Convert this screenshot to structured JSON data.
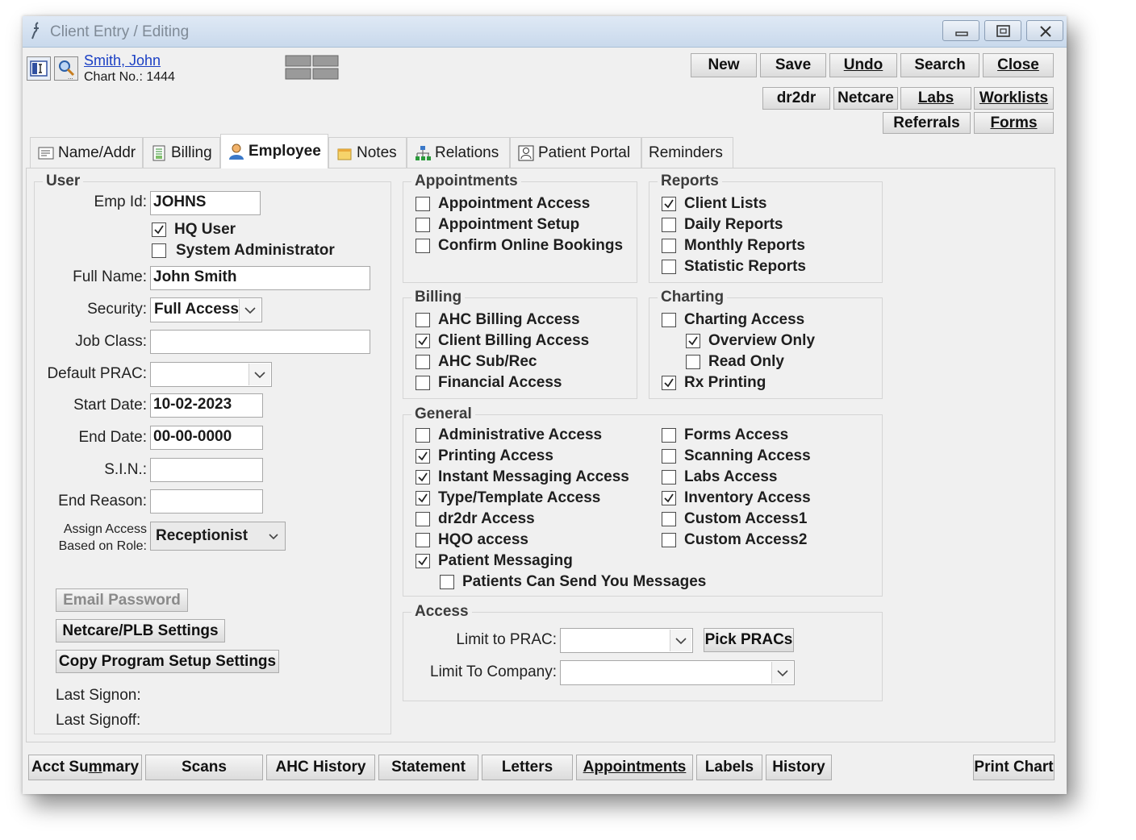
{
  "window": {
    "title": "Client Entry / Editing"
  },
  "patient": {
    "name": "Smith, John",
    "chart": "Chart No.: 1444"
  },
  "toolbar": {
    "new": "New",
    "save": "Save",
    "undo": "Undo",
    "search": "Search",
    "close": "Close",
    "dr2dr": "dr2dr",
    "netcare": "Netcare",
    "labs": "Labs",
    "worklists": "Worklists",
    "referrals": "Referrals",
    "forms": "Forms"
  },
  "tabs": [
    "Name/Addr",
    "Billing",
    "Employee",
    "Notes",
    "Relations",
    "Patient Portal",
    "Reminders"
  ],
  "user": {
    "legend": "User",
    "emp_id_label": "Emp Id:",
    "emp_id": "JOHNS",
    "hq_user": {
      "label": "HQ User",
      "checked": true
    },
    "sys_admin": {
      "label": "System Administrator",
      "checked": false
    },
    "full_name_label": "Full Name:",
    "full_name": "John Smith",
    "security_label": "Security:",
    "security": "Full Access",
    "job_class_label": "Job Class:",
    "job_class": "",
    "default_prac_label": "Default PRAC:",
    "default_prac": "",
    "start_date_label": "Start Date:",
    "start_date": "10-02-2023",
    "end_date_label": "End Date:",
    "end_date": "00-00-0000",
    "sin_label": "S.I.N.:",
    "sin": "",
    "end_reason_label": "End Reason:",
    "end_reason": "",
    "assign_label_1": "Assign Access",
    "assign_label_2": "Based on Role:",
    "role": "Receptionist",
    "email_password": "Email Password",
    "netcare_settings": "Netcare/PLB Settings",
    "copy_settings": "Copy Program Setup Settings",
    "last_signon": "Last Signon:",
    "last_signoff": "Last Signoff:"
  },
  "appointments": {
    "legend": "Appointments",
    "items": [
      {
        "label": "Appointment Access",
        "checked": false
      },
      {
        "label": "Appointment Setup",
        "checked": false
      },
      {
        "label": "Confirm Online Bookings",
        "checked": false
      }
    ]
  },
  "reports": {
    "legend": "Reports",
    "items": [
      {
        "label": "Client Lists",
        "checked": true
      },
      {
        "label": "Daily Reports",
        "checked": false
      },
      {
        "label": "Monthly Reports",
        "checked": false
      },
      {
        "label": "Statistic Reports",
        "checked": false
      }
    ]
  },
  "billing": {
    "legend": "Billing",
    "items": [
      {
        "label": "AHC Billing Access",
        "checked": false
      },
      {
        "label": "Client Billing Access",
        "checked": true
      },
      {
        "label": "AHC Sub/Rec",
        "checked": false
      },
      {
        "label": "Financial Access",
        "checked": false
      }
    ]
  },
  "charting": {
    "legend": "Charting",
    "items": [
      {
        "label": "Charting Access",
        "checked": false
      },
      {
        "label": "Overview Only",
        "checked": true
      },
      {
        "label": "Read Only",
        "checked": false
      },
      {
        "label": "Rx Printing",
        "checked": true
      }
    ]
  },
  "general": {
    "legend": "General",
    "left": [
      {
        "label": "Administrative Access",
        "checked": false
      },
      {
        "label": "Printing Access",
        "checked": true
      },
      {
        "label": "Instant Messaging Access",
        "checked": true
      },
      {
        "label": "Type/Template Access",
        "checked": true
      },
      {
        "label": "dr2dr Access",
        "checked": false
      },
      {
        "label": "HQO access",
        "checked": false
      },
      {
        "label": "Patient Messaging",
        "checked": true
      },
      {
        "label": "Patients Can Send You Messages",
        "checked": false
      }
    ],
    "right": [
      {
        "label": "Forms Access",
        "checked": false
      },
      {
        "label": "Scanning Access",
        "checked": false
      },
      {
        "label": "Labs Access",
        "checked": false
      },
      {
        "label": "Inventory Access",
        "checked": true
      },
      {
        "label": "Custom Access1",
        "checked": false
      },
      {
        "label": "Custom Access2",
        "checked": false
      }
    ]
  },
  "access": {
    "legend": "Access",
    "limit_prac_label": "Limit to PRAC:",
    "limit_prac": "",
    "pick_pracs": "Pick PRACs",
    "limit_company_label": "Limit To Company:",
    "limit_company": ""
  },
  "bottom": {
    "acct_summary_pre": "Acct Su",
    "acct_summary_u": "m",
    "acct_summary_post": "mary",
    "scans": "Scans",
    "ahc_history": "AHC History",
    "statement": "Statement",
    "letters": "Letters",
    "appointments": "Appointments",
    "labels": "Labels",
    "history": "History",
    "print_chart": "Print Chart"
  }
}
